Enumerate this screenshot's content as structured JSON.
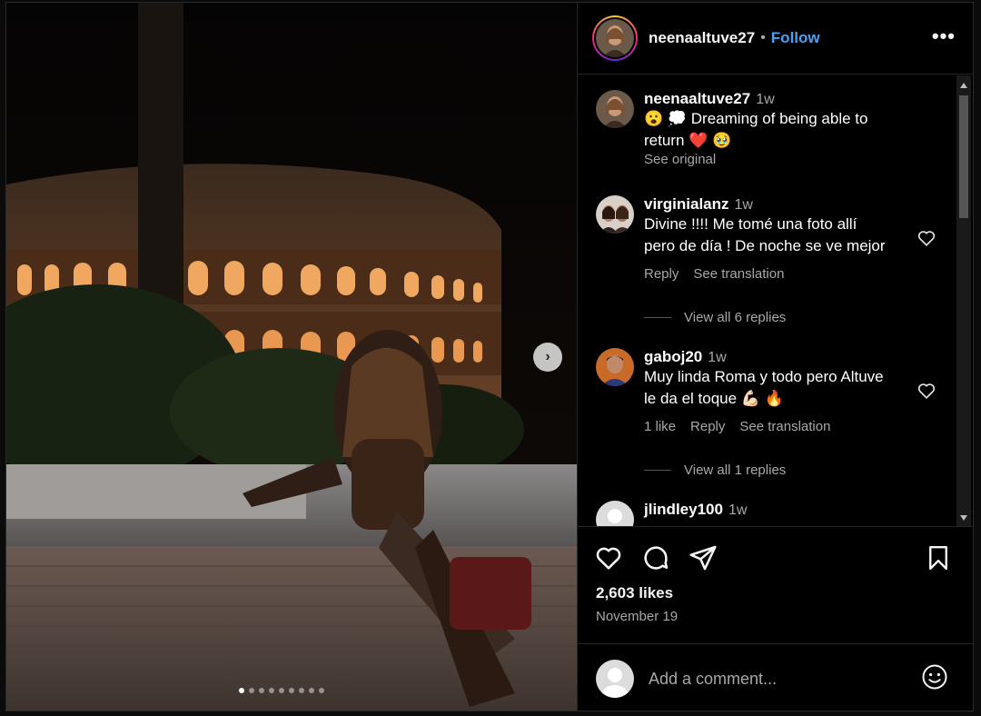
{
  "post": {
    "username": "neenaaltuve27",
    "follow_label": "Follow",
    "separator": "•",
    "more_label": "•••"
  },
  "photo": {
    "slide_count": 9,
    "active_slide": 0,
    "next_label": "›"
  },
  "caption": {
    "username": "neenaaltuve27",
    "time": "1w",
    "text_line1": "😮 💭 Dreaming of being able to",
    "text_line2": "return ❤️ 🥹",
    "see_original": "See original"
  },
  "comments": [
    {
      "username": "virginialanz",
      "time": "1w",
      "text_line1": "Divine !!!! Me tomé una foto allí",
      "text_line2": "pero de día ! De noche se ve mejor",
      "reply_label": "Reply",
      "translation_label": "See translation",
      "view_replies": "View all 6 replies"
    },
    {
      "username": "gaboj20",
      "time": "1w",
      "text_line1": "Muy linda Roma y todo pero Altuve",
      "text_line2": "le da el toque 💪🏻 🔥",
      "likes_label": "1 like",
      "reply_label": "Reply",
      "translation_label": "See translation",
      "view_replies": "View all 1 replies"
    },
    {
      "username": "jlindley100",
      "time": "1w"
    }
  ],
  "footer": {
    "likes": "2,603 likes",
    "date": "November 19",
    "add_comment_placeholder": "Add a comment..."
  },
  "colors": {
    "accent": "#4da0f0",
    "background": "#000000",
    "muted_text": "#a8a8a8",
    "heart_red": "#e0245e"
  }
}
